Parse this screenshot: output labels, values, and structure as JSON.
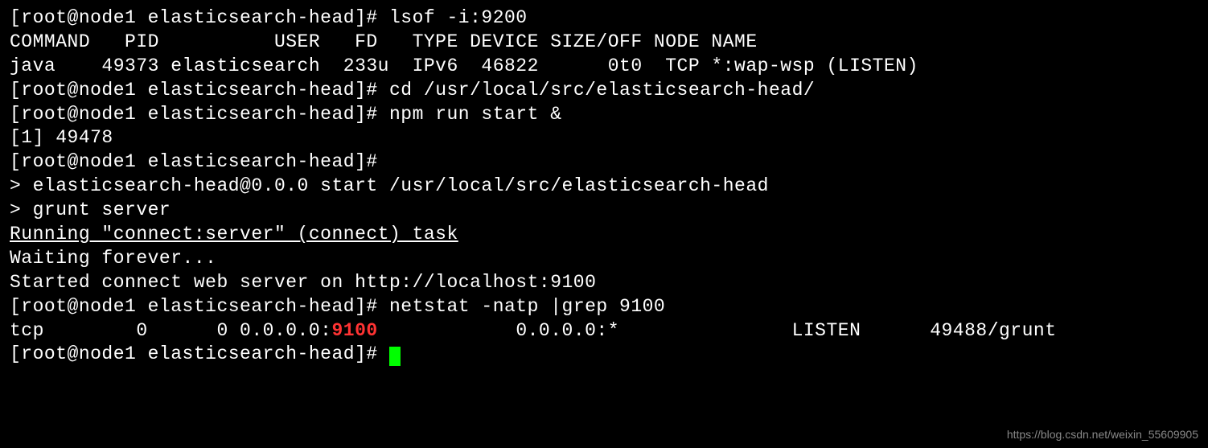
{
  "lines": {
    "l1_prompt": "[root@node1 elasticsearch-head]# ",
    "l1_cmd": "lsof -i:9200",
    "l2_header": "COMMAND   PID          USER   FD   TYPE DEVICE SIZE/OFF NODE NAME",
    "l3_row": "java    49373 elasticsearch  233u  IPv6  46822      0t0  TCP *:wap-wsp (LISTEN)",
    "l4_prompt": "[root@node1 elasticsearch-head]# ",
    "l4_cmd": "cd /usr/local/src/elasticsearch-head/",
    "l5_prompt": "[root@node1 elasticsearch-head]# ",
    "l5_cmd": "npm run start &",
    "l6": "[1] 49478",
    "l7_prompt": "[root@node1 elasticsearch-head]# ",
    "l8": "> elasticsearch-head@0.0.0 start /usr/local/src/elasticsearch-head",
    "l9": "> grunt server",
    "l10": "",
    "l11": "Running \"connect:server\" (connect) task",
    "l12": "Waiting forever...",
    "l13": "Started connect web server on http://localhost:9100",
    "l14": "",
    "l15_prompt": "[root@node1 elasticsearch-head]# ",
    "l15_cmd": "netstat -natp |grep 9100",
    "l16_pre": "tcp        0      0 0.0.0.0:",
    "l16_hl": "9100",
    "l16_mid": "            0.0.0.0:*               LISTEN      49488/grunt",
    "l17_prompt": "[root@node1 elasticsearch-head]# "
  },
  "watermark": "https://blog.csdn.net/weixin_55609905"
}
